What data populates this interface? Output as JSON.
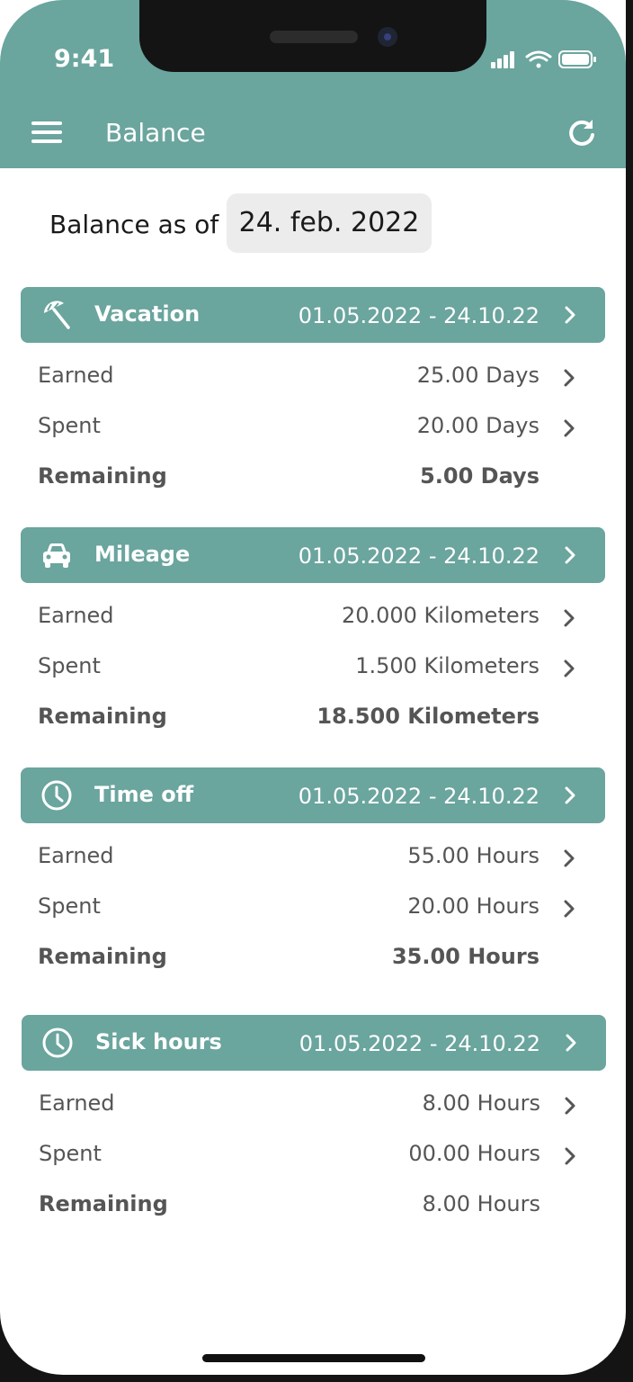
{
  "status_bar": {
    "time": "9:41"
  },
  "nav": {
    "title": "Balance"
  },
  "balance": {
    "label": "Balance as of",
    "date": "24. feb. 2022"
  },
  "sections": [
    {
      "title": "Vacation",
      "dates": "01.05.2022 - 24.10.22",
      "icon": "beach-umbrella-icon",
      "earned_label": "Earned",
      "earned_value": "25.00 Days",
      "spent_label": "Spent",
      "spent_value": "20.00 Days",
      "remaining_label": "Remaining",
      "remaining_value": "5.00 Days"
    },
    {
      "title": "Mileage",
      "dates": "01.05.2022 - 24.10.22",
      "icon": "car-icon",
      "earned_label": "Earned",
      "earned_value": "20.000 Kilometers",
      "spent_label": "Spent",
      "spent_value": "1.500 Kilometers",
      "remaining_label": "Remaining",
      "remaining_value": "18.500 Kilometers"
    },
    {
      "title": "Time off",
      "dates": "01.05.2022 - 24.10.22",
      "icon": "clock-icon",
      "earned_label": "Earned",
      "earned_value": "55.00 Hours",
      "spent_label": "Spent",
      "spent_value": "20.00 Hours",
      "remaining_label": "Remaining",
      "remaining_value": "35.00 Hours"
    },
    {
      "title": "Sick hours",
      "dates": "01.05.2022 - 24.10.22",
      "icon": "clock-icon",
      "earned_label": "Earned",
      "earned_value": "8.00 Hours",
      "spent_label": "Spent",
      "spent_value": "00.00 Hours",
      "remaining_label": "Remaining",
      "remaining_value": "8.00 Hours"
    }
  ],
  "colors": {
    "accent": "#6aa59e",
    "text": "#555555",
    "pill": "#ececec"
  }
}
